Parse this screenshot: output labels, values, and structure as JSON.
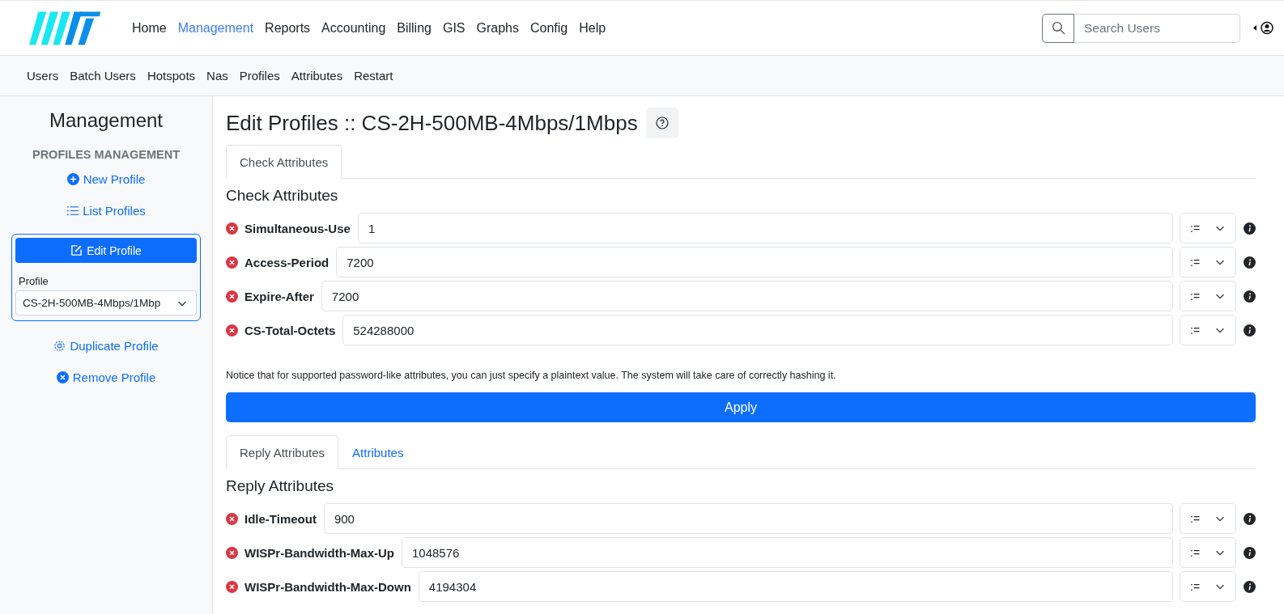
{
  "nav": {
    "items": [
      {
        "label": "Home",
        "selected": false
      },
      {
        "label": "Management",
        "selected": true
      },
      {
        "label": "Reports",
        "selected": false
      },
      {
        "label": "Accounting",
        "selected": false
      },
      {
        "label": "Billing",
        "selected": false
      },
      {
        "label": "GIS",
        "selected": false
      },
      {
        "label": "Graphs",
        "selected": false
      },
      {
        "label": "Config",
        "selected": false
      },
      {
        "label": "Help",
        "selected": false
      }
    ],
    "search": {
      "placeholder": "Search Users"
    }
  },
  "subnav": [
    "Users",
    "Batch Users",
    "Hotspots",
    "Nas",
    "Profiles",
    "Attributes",
    "Restart"
  ],
  "sidebar": {
    "title": "Management",
    "section": "PROFILES MANAGEMENT",
    "links_top": [
      {
        "kind": "plus",
        "label": "New Profile"
      },
      {
        "kind": "list",
        "label": "List Profiles"
      }
    ],
    "edit_button": "Edit Profile",
    "profile_label": "Profile",
    "profile_value": "CS-2H-500MB-4Mbps/1Mbp",
    "links_bottom": [
      {
        "kind": "gear",
        "label": "Duplicate Profile"
      },
      {
        "kind": "remove",
        "label": "Remove Profile"
      }
    ]
  },
  "page": {
    "title": "Edit Profiles :: CS-2H-500MB-4Mbps/1Mbps",
    "check_tabs": [
      {
        "label": "Check Attributes",
        "selected": true
      }
    ],
    "check_heading": "Check Attributes",
    "check_rows": [
      {
        "name": "Simultaneous-Use",
        "value": "1",
        "op": ":="
      },
      {
        "name": "Access-Period",
        "value": "7200",
        "op": ":="
      },
      {
        "name": "Expire-After",
        "value": "7200",
        "op": ":="
      },
      {
        "name": "CS-Total-Octets",
        "value": "524288000",
        "op": ":="
      }
    ],
    "notice": "Notice that for supported password-like attributes, you can just specify a plaintext value. The system will take care of correctly hashing it.",
    "apply": "Apply",
    "reply_tabs": [
      {
        "label": "Reply Attributes",
        "selected": true
      },
      {
        "label": "Attributes",
        "selected": false
      }
    ],
    "reply_heading": "Reply Attributes",
    "reply_rows": [
      {
        "name": "Idle-Timeout",
        "value": "900",
        "op": ":="
      },
      {
        "name": "WISPr-Bandwidth-Max-Up",
        "value": "1048576",
        "op": ":="
      },
      {
        "name": "WISPr-Bandwidth-Max-Down",
        "value": "4194304",
        "op": ":="
      }
    ]
  }
}
